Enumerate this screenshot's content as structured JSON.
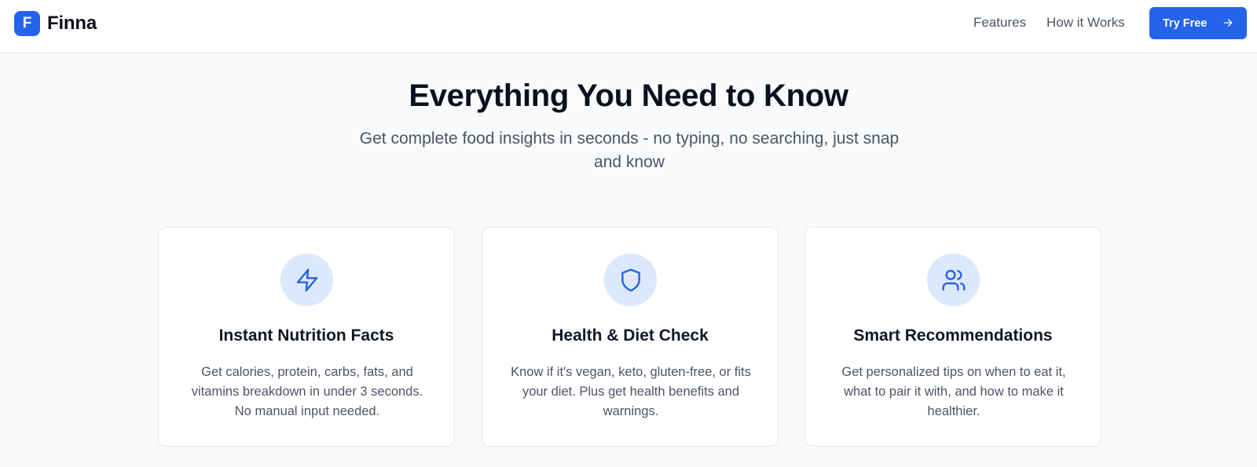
{
  "nav": {
    "logo_letter": "F",
    "brand": "Finna",
    "links": [
      "Features",
      "How it Works"
    ],
    "cta_label": "Try Free"
  },
  "hero": {
    "title": "Everything You Need to Know",
    "subtitle": "Get complete food insights in seconds - no typing, no searching, just snap and know"
  },
  "features": [
    {
      "icon": "lightning-icon",
      "title": "Instant Nutrition Facts",
      "description": "Get calories, protein, carbs, fats, and vitamins breakdown in under 3 seconds. No manual input needed."
    },
    {
      "icon": "shield-icon",
      "title": "Health & Diet Check",
      "description": "Know if it's vegan, keto, gluten-free, or fits your diet. Plus get health benefits and warnings."
    },
    {
      "icon": "users-icon",
      "title": "Smart Recommendations",
      "description": "Get personalized tips on when to eat it, what to pair it with, and how to make it healthier."
    }
  ],
  "colors": {
    "accent": "#2563eb",
    "icon_circle": "#dce8fb",
    "background": "#f8fafc"
  }
}
